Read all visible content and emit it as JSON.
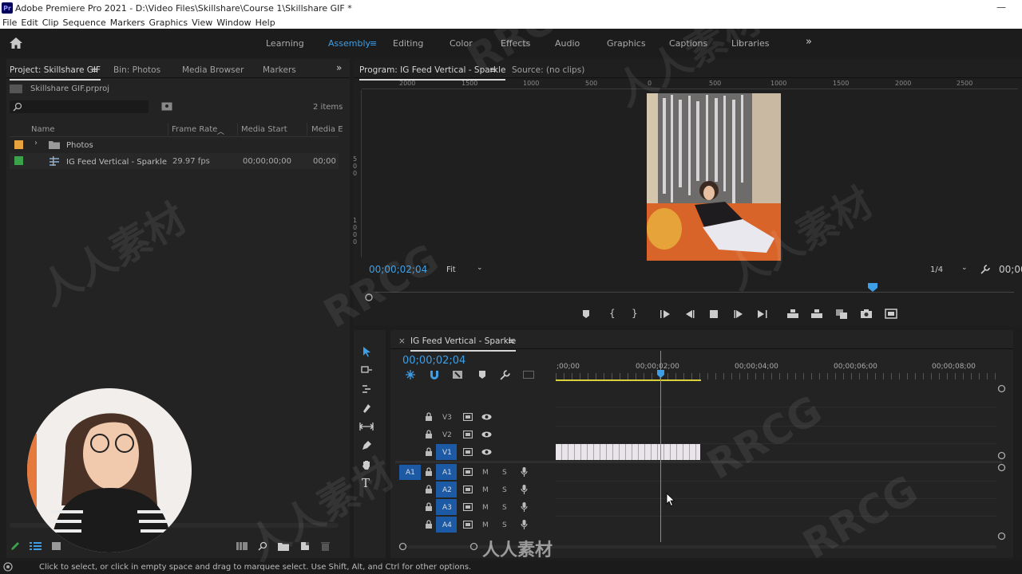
{
  "titlebar": {
    "app_title": "Adobe Premiere Pro 2021 - D:\\Video Files\\Skillshare\\Course 1\\Skillshare GIF *",
    "logo": "Pr"
  },
  "menu": [
    "File",
    "Edit",
    "Clip",
    "Sequence",
    "Markers",
    "Graphics",
    "View",
    "Window",
    "Help"
  ],
  "workspaces": {
    "items": [
      "Learning",
      "Assembly",
      "Editing",
      "Color",
      "Effects",
      "Audio",
      "Graphics",
      "Captions",
      "Libraries"
    ],
    "active": "Assembly",
    "overflow": "»"
  },
  "project_panel": {
    "tabs": [
      "Project: Skillshare GIF",
      "Bin: Photos",
      "Media Browser",
      "Markers"
    ],
    "file_name": "Skillshare GIF.prproj",
    "item_count": "2 items",
    "columns": [
      "Name",
      "Frame Rate",
      "Media Start",
      "Media E"
    ],
    "rows": [
      {
        "name": "Photos",
        "frame_rate": "",
        "media_start": "",
        "media_end": "",
        "color": "#e8a33d",
        "type": "bin"
      },
      {
        "name": "IG Feed Vertical - Sparkle",
        "frame_rate": "29.97 fps",
        "media_start": "00;00;00;00",
        "media_end": "00;00",
        "color": "#3aa24a",
        "type": "sequence"
      }
    ]
  },
  "program_monitor": {
    "tab": "Program: IG Feed Vertical - Sparkle",
    "source_tab": "Source: (no clips)",
    "timecode": "00;00;02;04",
    "fit": "Fit",
    "resolution": "1/4",
    "end_timecode": "00;00",
    "ruler": [
      "2000",
      "1500",
      "1000",
      "500",
      "0",
      "500",
      "1000",
      "1500",
      "2000",
      "2500"
    ],
    "vruler": [
      "5",
      "0",
      "0",
      "5",
      "0",
      "0",
      "1",
      "0",
      "0",
      "0"
    ]
  },
  "timeline": {
    "tab": "IG Feed Vertical - Sparkle",
    "timecode": "00;00;02;04",
    "time_labels": [
      ";00;00",
      "00;00;02;00",
      "00;00;04;00",
      "00;00;06;00",
      "00;00;08;00"
    ],
    "video_tracks": [
      "V3",
      "V2",
      "V1"
    ],
    "audio_tracks": [
      "A1",
      "A2",
      "A3",
      "A4"
    ],
    "source_patch": "A1",
    "audio_m": "M",
    "audio_s": "S"
  },
  "status": {
    "message": "Click to select, or click in empty space and drag to marquee select. Use Shift, Alt, and Ctrl for other options."
  },
  "watermarks": [
    "RRCG",
    "人人素材",
    "RRCG",
    "人人素材",
    "RRCG",
    "人人素材",
    "RRCG",
    "人人素材"
  ],
  "logo_watermark": "人人素材",
  "colors": {
    "accent": "#3d9fe8",
    "clip": "#e9e3ea",
    "track_active": "#1c5aa5"
  }
}
